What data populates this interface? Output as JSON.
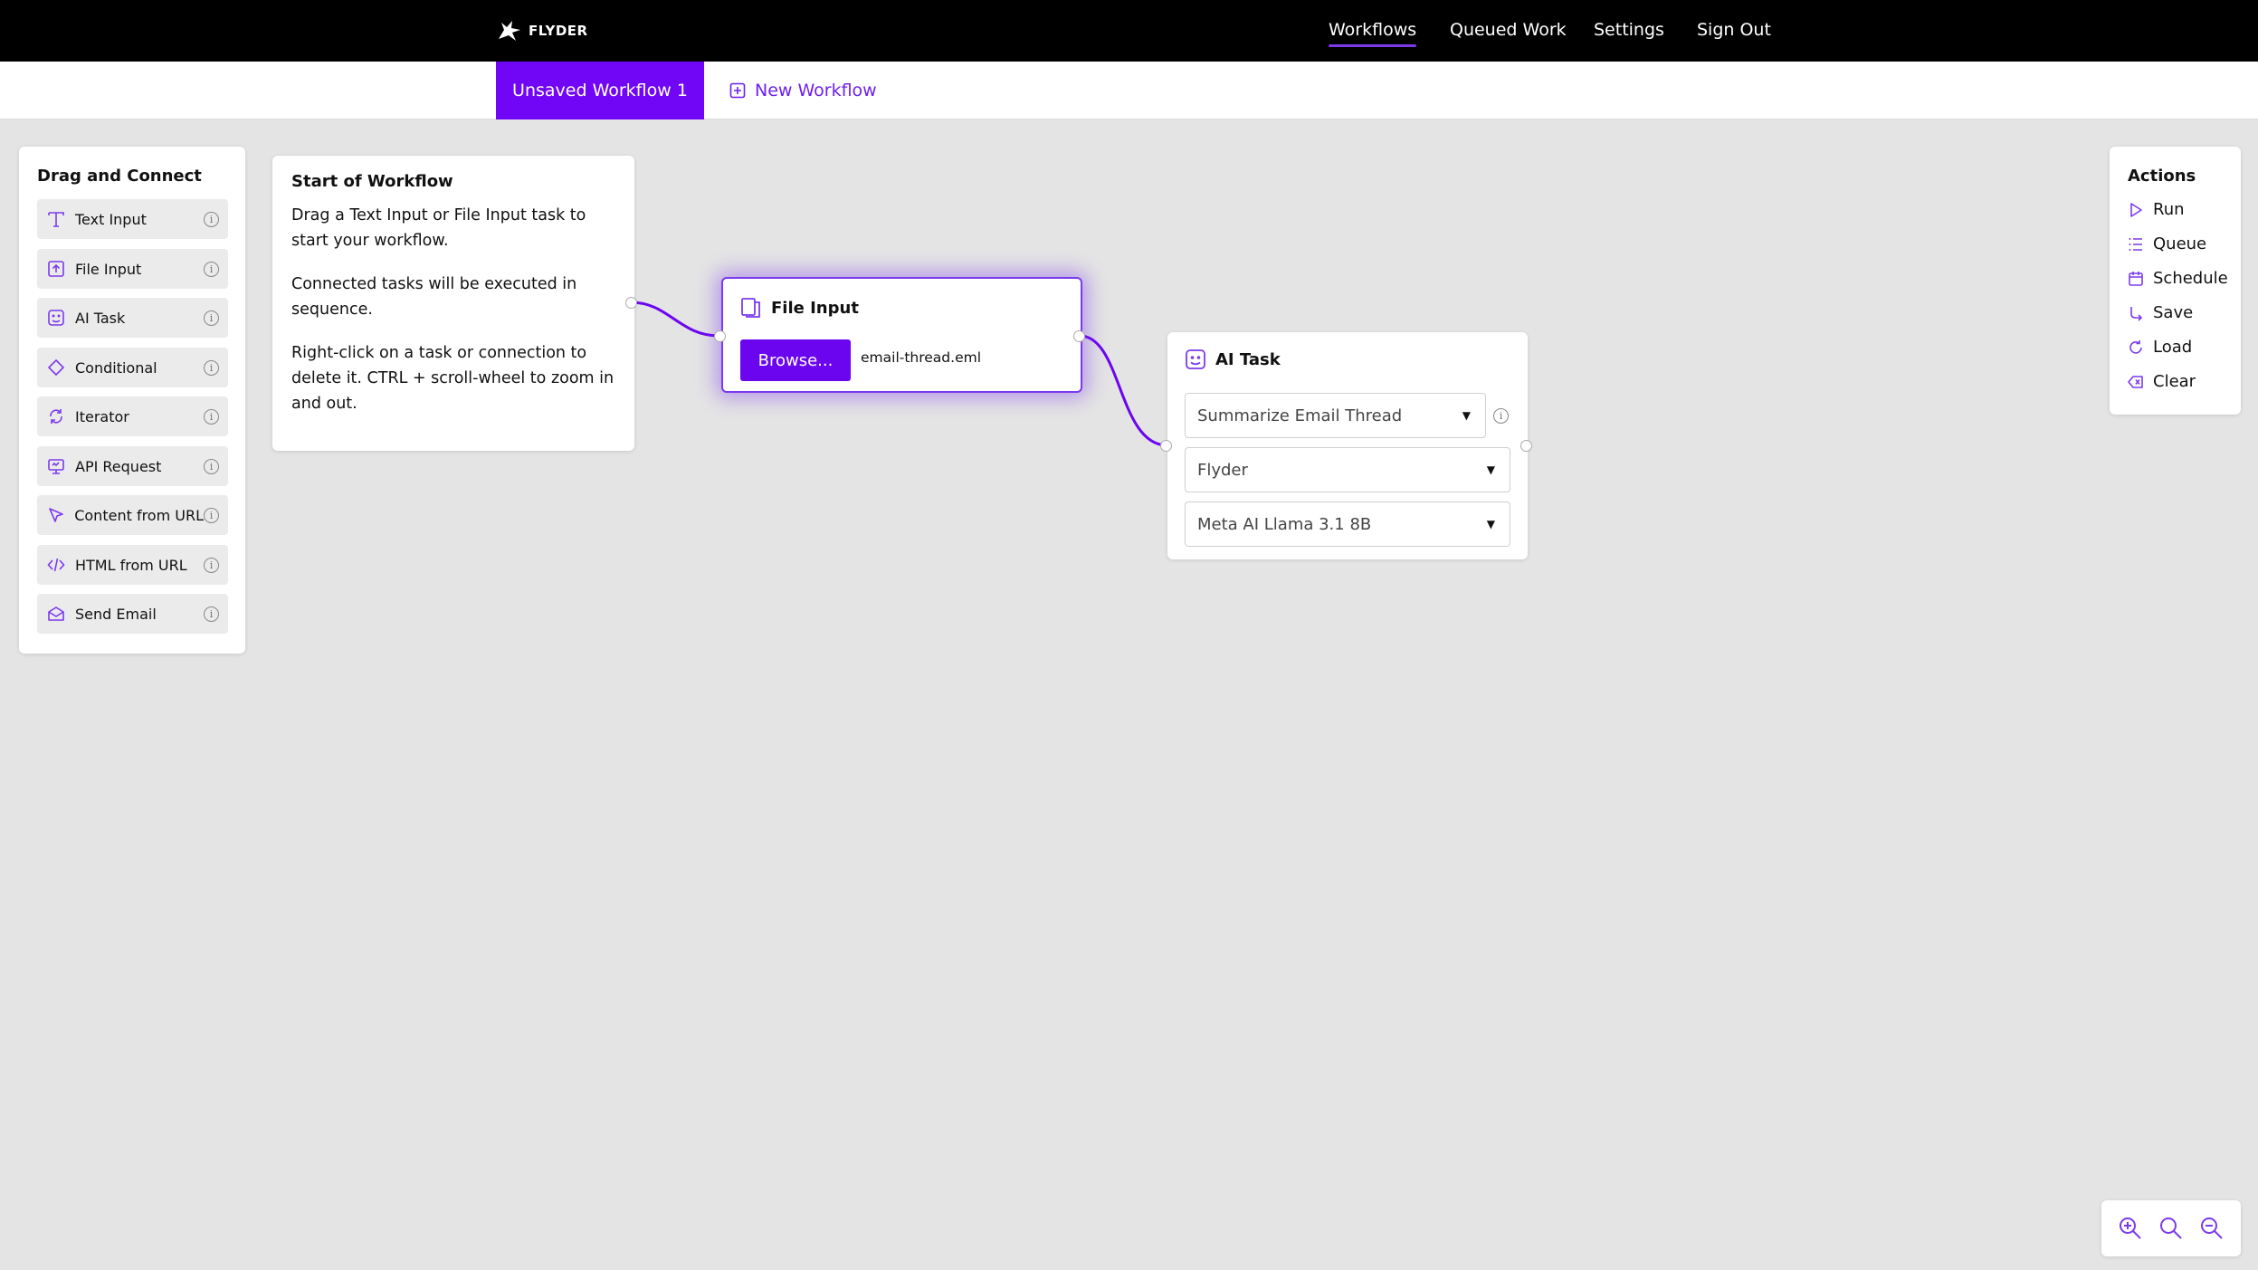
{
  "brand": {
    "name": "FLYDER",
    "accent": "#7105f5"
  },
  "nav": {
    "workflows": "Workflows",
    "queued_work": "Queued Work",
    "settings": "Settings",
    "sign_out": "Sign Out",
    "active": "Workflows"
  },
  "tabs": {
    "active_label": "Unsaved Workflow 1",
    "new_label": "New Workflow"
  },
  "palette": {
    "title": "Drag and Connect",
    "items": [
      {
        "label": "Text Input",
        "icon": "text-icon"
      },
      {
        "label": "File Input",
        "icon": "file-upload-icon"
      },
      {
        "label": "AI Task",
        "icon": "robot-icon"
      },
      {
        "label": "Conditional",
        "icon": "diamond-icon"
      },
      {
        "label": "Iterator",
        "icon": "loop-icon"
      },
      {
        "label": "API Request",
        "icon": "api-icon"
      },
      {
        "label": "Content from URL",
        "icon": "cursor-icon"
      },
      {
        "label": "HTML from URL",
        "icon": "code-icon"
      },
      {
        "label": "Send Email",
        "icon": "email-icon"
      }
    ]
  },
  "start_card": {
    "title": "Start of Workflow",
    "para1": "Drag a Text Input or File Input task to start your workflow.",
    "para2": "Connected tasks will be executed in sequence.",
    "para3": "Right-click on a task or connection to delete it. CTRL + scroll-wheel to zoom in and out."
  },
  "file_node": {
    "title": "File Input",
    "browse_label": "Browse...",
    "file_name": "email-thread.eml"
  },
  "ai_node": {
    "title": "AI Task",
    "task_value": "Summarize Email Thread",
    "provider_value": "Flyder",
    "model_value": "Meta AI Llama 3.1 8B"
  },
  "actions": {
    "title": "Actions",
    "items": [
      {
        "label": "Run",
        "icon": "play-icon"
      },
      {
        "label": "Queue",
        "icon": "list-icon"
      },
      {
        "label": "Schedule",
        "icon": "calendar-icon"
      },
      {
        "label": "Save",
        "icon": "save-icon"
      },
      {
        "label": "Load",
        "icon": "refresh-icon"
      },
      {
        "label": "Clear",
        "icon": "backspace-icon"
      }
    ]
  },
  "zoom": {
    "buttons": [
      "zoom-in-icon",
      "zoom-reset-icon",
      "zoom-out-icon"
    ]
  }
}
